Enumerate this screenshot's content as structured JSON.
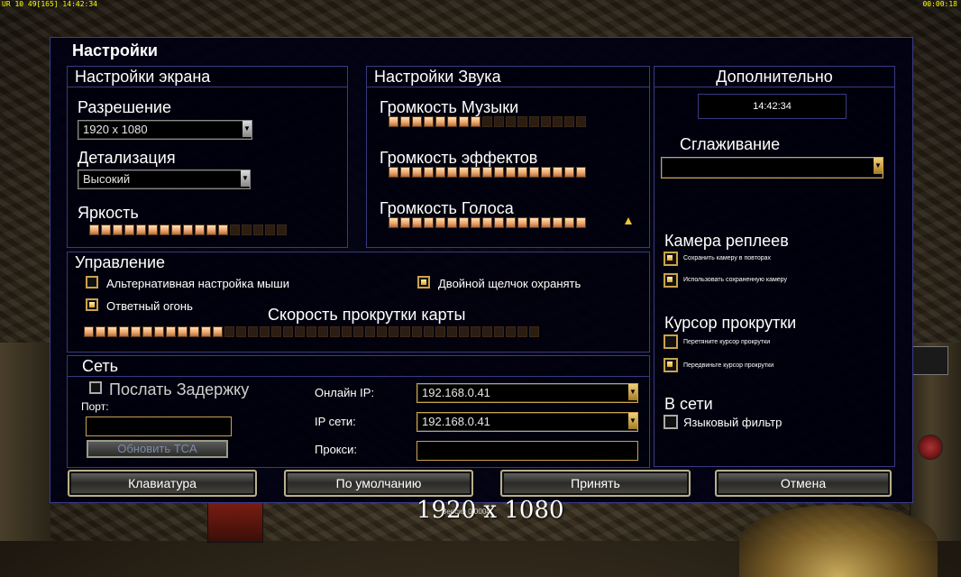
{
  "topbar": {
    "left": "UR 10 49[165] 14:42:34",
    "right": "00:00:18"
  },
  "dialog": {
    "title": "Настройки"
  },
  "screen": {
    "title": "Настройки экрана",
    "resolution_label": "Разрешение",
    "resolution_value": "1920 x 1080",
    "detail_label": "Детализация",
    "detail_value": "Высокий",
    "brightness_label": "Яркость",
    "brightness_level": "12/17"
  },
  "sound": {
    "title": "Настройки Звука",
    "music_label": "Громкость Музыки",
    "music_level": "8/17",
    "effects_label": "Громкость эффектов",
    "effects_level": "17/17",
    "voice_label": "Громкость Голоса",
    "voice_level": "17/17"
  },
  "extra": {
    "title": "Дополнительно",
    "time": "14:42:34",
    "antialias_label": "Сглаживание",
    "antialias_value": "",
    "replay_cam_title": "Камера реплеев",
    "replay_save_label": "Сохранить камеру в повторах",
    "replay_use_label": "Использовать сохраненную камеру",
    "scroll_cursor_title": "Курсор прокрутки",
    "scroll_drag_label": "Перетяните курсор прокрутки",
    "scroll_move_label": "Передвиньте курсор прокрутки",
    "online_title": "В сети",
    "language_filter_label": "Языковый фильтр"
  },
  "controls": {
    "title": "Управление",
    "alt_mouse_label": "Альтернативная настройка мыши",
    "double_click_label": "Двойной щелчок охранять",
    "return_fire_label": "Ответный огонь",
    "scroll_speed_label": "Скорость прокрутки карты",
    "scroll_speed_level": "12/39"
  },
  "network": {
    "title": "Сеть",
    "send_delay_label": "Послать Задержку",
    "port_label": "Порт:",
    "port_value": "",
    "update_tca_label": "Обновить TCA",
    "online_ip_label": "Онлайн IP:",
    "online_ip_value": "192.168.0.41",
    "lan_ip_label": "IP сети:",
    "lan_ip_value": "192.168.0.41",
    "proxy_label": "Прокси:",
    "proxy_value": ""
  },
  "buttons": {
    "keyboard": "Клавиатура",
    "defaults": "По умолчанию",
    "accept": "Принять",
    "cancel": "Отмена"
  },
  "overlay": {
    "resolution": "1920 x 1080",
    "version": "Версия 0.0004"
  },
  "colors": {
    "accent_gold": "#caa24a",
    "border_blue": "#3a3a80",
    "slider_on": "#e9a26a"
  }
}
